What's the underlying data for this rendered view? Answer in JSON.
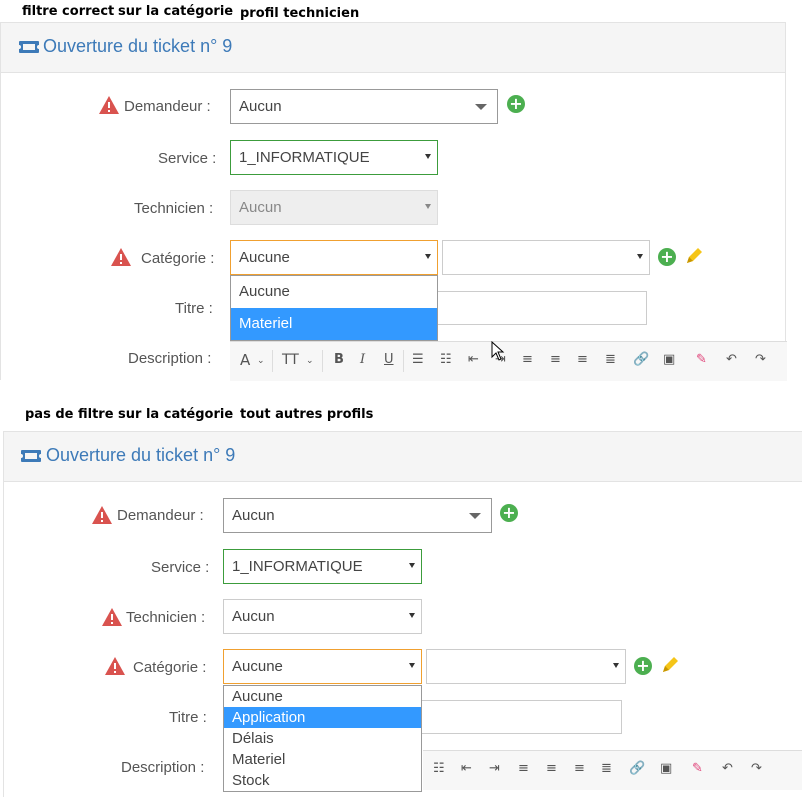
{
  "captions": {
    "top_1": "filtre correct",
    "top_2": "sur la catégorie",
    "top_3": "profil technicien",
    "bottom_1": "pas de filtre sur la catégorie",
    "bottom_2": "tout autres profils"
  },
  "form": {
    "title": "Ouverture du ticket n° 9",
    "labels": {
      "demandeur": "Demandeur :",
      "service": "Service :",
      "technicien": "Technicien :",
      "categorie": "Catégorie :",
      "titre": "Titre :",
      "description": "Description :"
    },
    "values": {
      "demandeur": "Aucun",
      "service": "1_INFORMATIQUE",
      "technicien": "Aucun",
      "categorie": "Aucune"
    }
  },
  "top_dropdown": [
    "Aucune",
    "Materiel"
  ],
  "top_dropdown_selected": "Materiel",
  "bottom_dropdown": [
    "Aucune",
    "Application",
    "Délais",
    "Materiel",
    "Stock"
  ],
  "bottom_dropdown_selected": "Application",
  "toolbar": {
    "font_glyph": "A",
    "size_glyph": "TT",
    "bold": "B",
    "italic": "I",
    "underline": "U"
  },
  "icons": {
    "ticket": "ticket-icon",
    "warning": "warning-icon",
    "add": "plus-circle-icon",
    "edit": "pencil-icon"
  },
  "colors": {
    "title_blue": "#3d7ab8",
    "warning_red": "#d9534f",
    "add_green": "#4caf50",
    "selected_blue": "#3399ff",
    "service_border": "#3c9c3c",
    "focus_border": "#f0a030"
  }
}
